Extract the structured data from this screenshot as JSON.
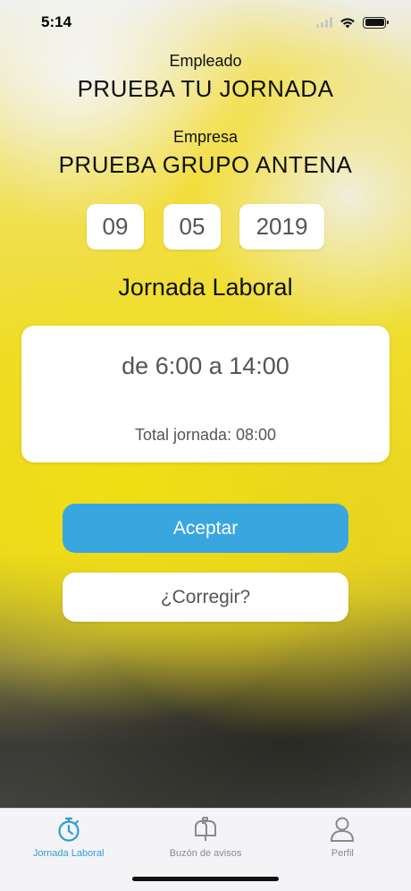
{
  "status_bar": {
    "time": "5:14"
  },
  "employee": {
    "label": "Empleado",
    "name": "PRUEBA TU JORNADA"
  },
  "company": {
    "label": "Empresa",
    "name": "PRUEBA GRUPO ANTENA"
  },
  "date": {
    "day": "09",
    "month": "05",
    "year": "2019"
  },
  "section_title": "Jornada Laboral",
  "schedule": {
    "range": "de 6:00 a 14:00",
    "total": "Total jornada: 08:00"
  },
  "buttons": {
    "accept": "Aceptar",
    "correct": "¿Corregir?"
  },
  "tabbar": {
    "items": [
      {
        "label": "Jornada Laboral",
        "icon": "stopwatch-icon",
        "active": true
      },
      {
        "label": "Buzón de avisos",
        "icon": "mailbox-icon",
        "active": false
      },
      {
        "label": "Perfil",
        "icon": "person-icon",
        "active": false
      }
    ]
  },
  "colors": {
    "accent": "#3aa6e0",
    "active_tab": "#2a9fdc",
    "inactive_tab": "#8a8a8e"
  }
}
